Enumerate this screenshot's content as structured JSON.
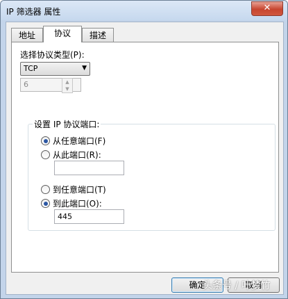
{
  "window": {
    "title": "IP 筛选器 属性",
    "close_glyph": "✕"
  },
  "tabs": [
    {
      "label": "地址"
    },
    {
      "label": "协议"
    },
    {
      "label": "描述"
    }
  ],
  "protocol": {
    "type_label": "选择协议类型(P):",
    "selected_type": "TCP",
    "number_value": "6"
  },
  "ports": {
    "group_title": "设置 IP 协议端口:",
    "from_any_label": "从任意端口(F)",
    "from_this_label": "从此端口(R):",
    "from_this_value": "",
    "to_any_label": "到任意端口(T)",
    "to_this_label": "到此端口(O):",
    "to_this_value": "445",
    "from_selected": "from_any",
    "to_selected": "to_this"
  },
  "footer": {
    "ok_label": "确定",
    "cancel_label": "取消"
  },
  "watermark": "头条号 / 叶梦竹"
}
